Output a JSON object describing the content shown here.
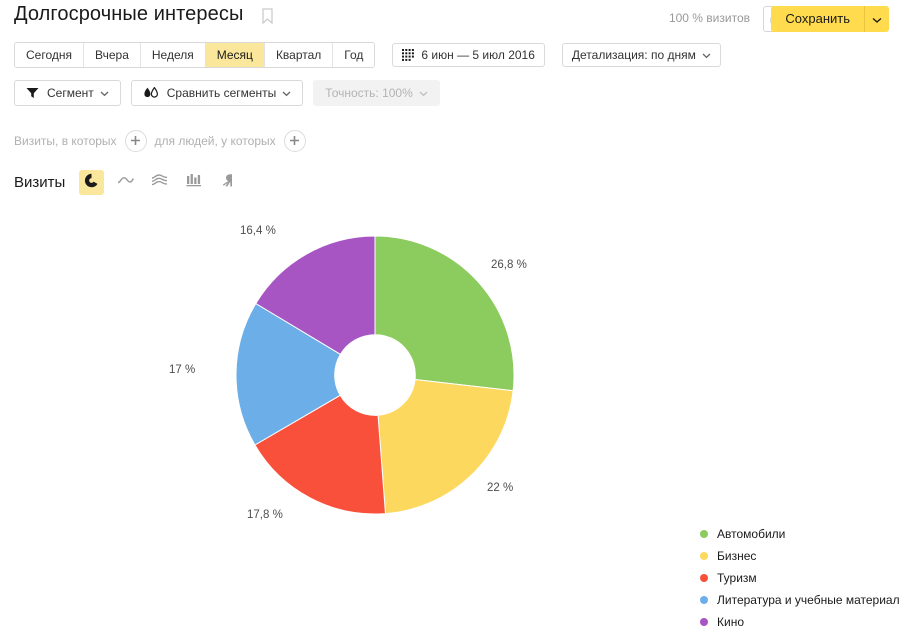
{
  "header": {
    "title": "Долгосрочные интересы",
    "bookmark_icon": "bookmark-icon",
    "visits_share": "100 % визитов",
    "export_icon": "export-icon",
    "save_label": "Сохранить",
    "save_caret_icon": "chevron-down-icon"
  },
  "toolbar": {
    "periods": [
      {
        "label": "Сегодня",
        "active": false
      },
      {
        "label": "Вчера",
        "active": false
      },
      {
        "label": "Неделя",
        "active": false
      },
      {
        "label": "Месяц",
        "active": true
      },
      {
        "label": "Квартал",
        "active": false
      },
      {
        "label": "Год",
        "active": false
      }
    ],
    "date_range": "6 июн — 5 июл 2016",
    "calendar_icon": "calendar-icon",
    "detalization": "Детализация: по дням",
    "segment_label": "Сегмент",
    "segment_icon": "funnel-icon",
    "compare_label": "Сравнить сегменты",
    "compare_icon": "compare-drops-icon",
    "accuracy_label": "Точность: 100%"
  },
  "filters": {
    "visits_prefix": "Визиты, в которых",
    "people_prefix": "для людей, у которых",
    "add_icon": "plus-icon"
  },
  "metric": {
    "label": "Визиты",
    "chart_types": [
      {
        "name": "pie-chart-icon",
        "active": true
      },
      {
        "name": "line-chart-icon",
        "active": false
      },
      {
        "name": "area-chart-icon",
        "active": false
      },
      {
        "name": "bar-chart-icon",
        "active": false
      },
      {
        "name": "map-chart-icon",
        "active": false
      }
    ]
  },
  "chart_data": {
    "type": "pie",
    "title": "Долгосрочные интересы",
    "donut": true,
    "inner_radius_ratio": 0.29,
    "start_angle": 0,
    "direction": "clockwise",
    "legend_position": "right",
    "categories": [
      "Автомобили",
      "Бизнес",
      "Туризм",
      "Литература и учебные материалы",
      "Кино"
    ],
    "values": [
      26.8,
      22,
      17.8,
      17,
      16.4
    ],
    "labels": [
      "26,8 %",
      "22 %",
      "17,8 %",
      "17 %",
      "16,4 %"
    ],
    "colors": [
      "#8ccb5e",
      "#fdd85e",
      "#f9503c",
      "#6cafe8",
      "#a855c4"
    ],
    "unit": "%"
  },
  "colors": {
    "accent": "#ffdb4d",
    "accent_soft": "#fbe79b",
    "text": "#1a1a1a",
    "muted": "#b0b0b0"
  }
}
